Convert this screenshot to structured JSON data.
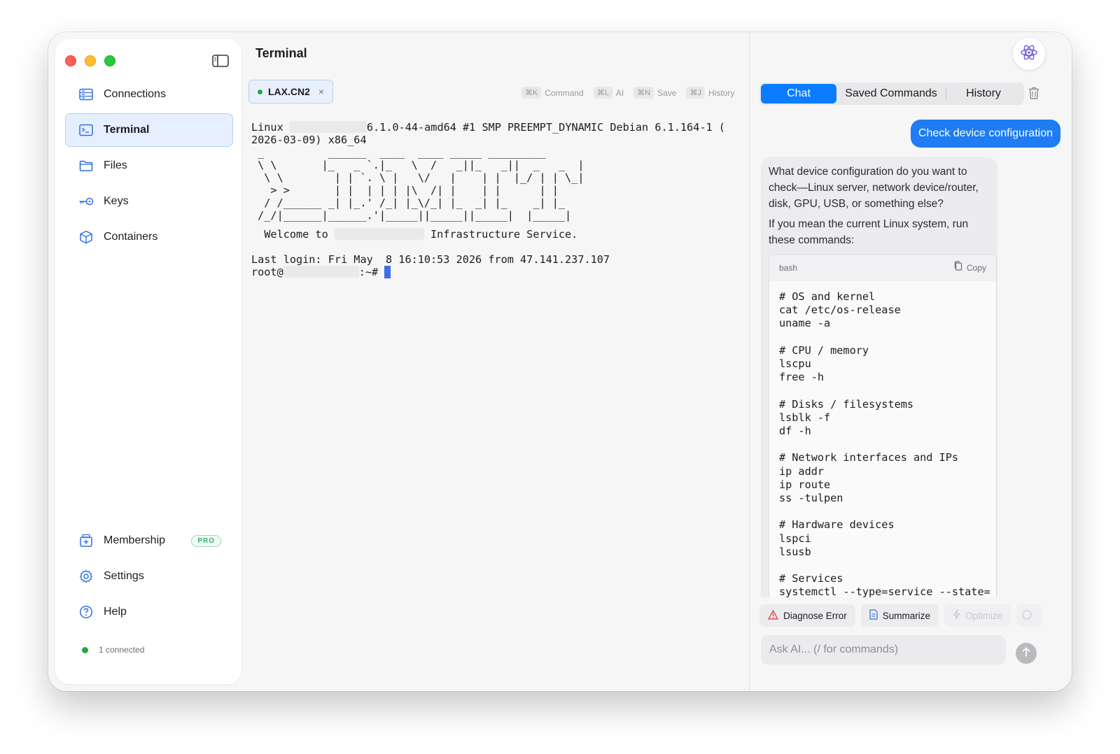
{
  "sidebar": {
    "nav": [
      {
        "label": "Connections",
        "icon": "server-icon"
      },
      {
        "label": "Terminal",
        "icon": "terminal-icon",
        "active": true
      },
      {
        "label": "Files",
        "icon": "folder-icon"
      },
      {
        "label": "Keys",
        "icon": "key-icon"
      },
      {
        "label": "Containers",
        "icon": "cube-icon"
      }
    ],
    "bottom": [
      {
        "label": "Membership",
        "icon": "membership-icon",
        "badge": "PRO"
      },
      {
        "label": "Settings",
        "icon": "gear-icon"
      },
      {
        "label": "Help",
        "icon": "help-icon"
      }
    ],
    "status": "1 connected"
  },
  "terminal": {
    "title": "Terminal",
    "tab": {
      "label": "LAX.CN2",
      "close": "×"
    },
    "shortcuts": [
      {
        "key": "⌘K",
        "label": "Command"
      },
      {
        "key": "⌘L",
        "label": "AI"
      },
      {
        "key": "⌘N",
        "label": "Save"
      },
      {
        "key": "⌘J",
        "label": "History"
      }
    ],
    "lines": {
      "l1_a": "Linux ",
      "l1_b": "6.1.0-44-amd64 #1 SMP PREEMPT_DYNAMIC Debian 6.1.164-1 (",
      "l2": "2026-03-09) x86_64",
      "art": [
        " _          ______  ____  ____ _____ _________",
        " \\ \\       |_   _ `.|_   \\  /   _||_   _||  _   _  |",
        "  \\ \\        | | `. \\ |   \\/   |    | |  |_/ | | \\_|",
        "   > >       | |  | | | |\\  /| |    | |      | |",
        "  / /______ _| |_.' /_| |_\\/_| |_  _| |_    _| |_",
        " /_/|______|______.'|_____||_____||_____|  |_____|"
      ],
      "welcome_a": "  Welcome to ",
      "welcome_b": " Infrastructure Service.",
      "last_login": "Last login: Fri May  8 16:10:53 2026 from 47.141.237.107",
      "prompt_a": "root@",
      "prompt_b": ":~# "
    }
  },
  "ai": {
    "tabs": [
      "Chat",
      "Saved Commands",
      "History"
    ],
    "active_tab": "Chat",
    "user_message": "Check device configuration",
    "assistant": {
      "p1": "What device configuration do you want to check—Linux server, network device/router, disk, GPU, USB, or something else?",
      "p2": "If you mean the current Linux system, run these commands:",
      "code_lang": "bash",
      "copy_label": "Copy",
      "code": [
        "# OS and kernel",
        "cat /etc/os-release",
        "uname -a",
        "",
        "# CPU / memory",
        "lscpu",
        "free -h",
        "",
        "# Disks / filesystems",
        "lsblk -f",
        "df -h",
        "",
        "# Network interfaces and IPs",
        "ip addr",
        "ip route",
        "ss -tulpen",
        "",
        "# Hardware devices",
        "lspci",
        "lsusb",
        "",
        "# Services",
        "systemctl --type=service --state="
      ]
    },
    "actions": [
      "Diagnose Error",
      "Summarize",
      "Optimize"
    ],
    "input_placeholder": "Ask AI... (/ for commands)"
  },
  "colors": {
    "accent": "#0a7cff",
    "active_bg": "#e6efff",
    "online": "#28a745",
    "pro": "#2fb56a"
  }
}
